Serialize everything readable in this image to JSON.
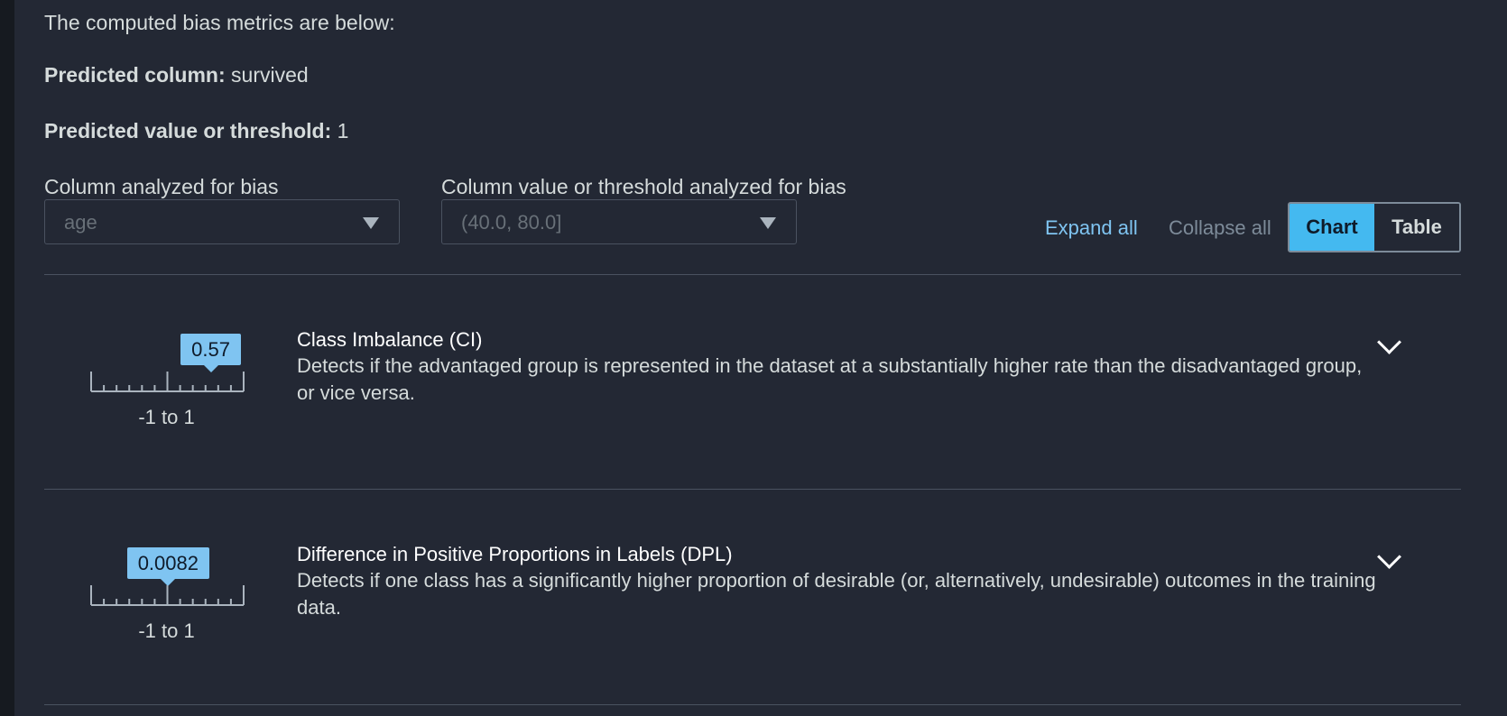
{
  "intro_text": "The computed bias metrics are below:",
  "predicted_column": {
    "label": "Predicted column:",
    "value": "survived"
  },
  "predicted_value": {
    "label": "Predicted value or threshold:",
    "value": "1"
  },
  "column_select": {
    "label": "Column analyzed for bias",
    "value": "age"
  },
  "threshold_select": {
    "label": "Column value or threshold analyzed for bias",
    "value": "(40.0, 80.0]"
  },
  "toolbar": {
    "expand_all": "Expand all",
    "collapse_all": "Collapse all",
    "chart": "Chart",
    "table": "Table",
    "selected_view": "Chart"
  },
  "colors": {
    "panel_bg": "#232834",
    "accent": "#44b9f0",
    "value_bubble": "#7fc4f1",
    "link": "#7fc4f1"
  },
  "metrics": [
    {
      "value_text": "0.57",
      "value": 0.57,
      "range": "-1 to 1",
      "min": -1,
      "max": 1,
      "title": "Class Imbalance (CI)",
      "description": "Detects if the advantaged group is represented in the dataset at a substantially higher rate than the disadvantaged group, or vice versa."
    },
    {
      "value_text": "0.0082",
      "value": 0.0082,
      "range": "-1 to 1",
      "min": -1,
      "max": 1,
      "title": "Difference in Positive Proportions in Labels (DPL)",
      "description": "Detects if one class has a significantly higher proportion of desirable (or, alternatively, undesirable) outcomes in the training data."
    }
  ]
}
